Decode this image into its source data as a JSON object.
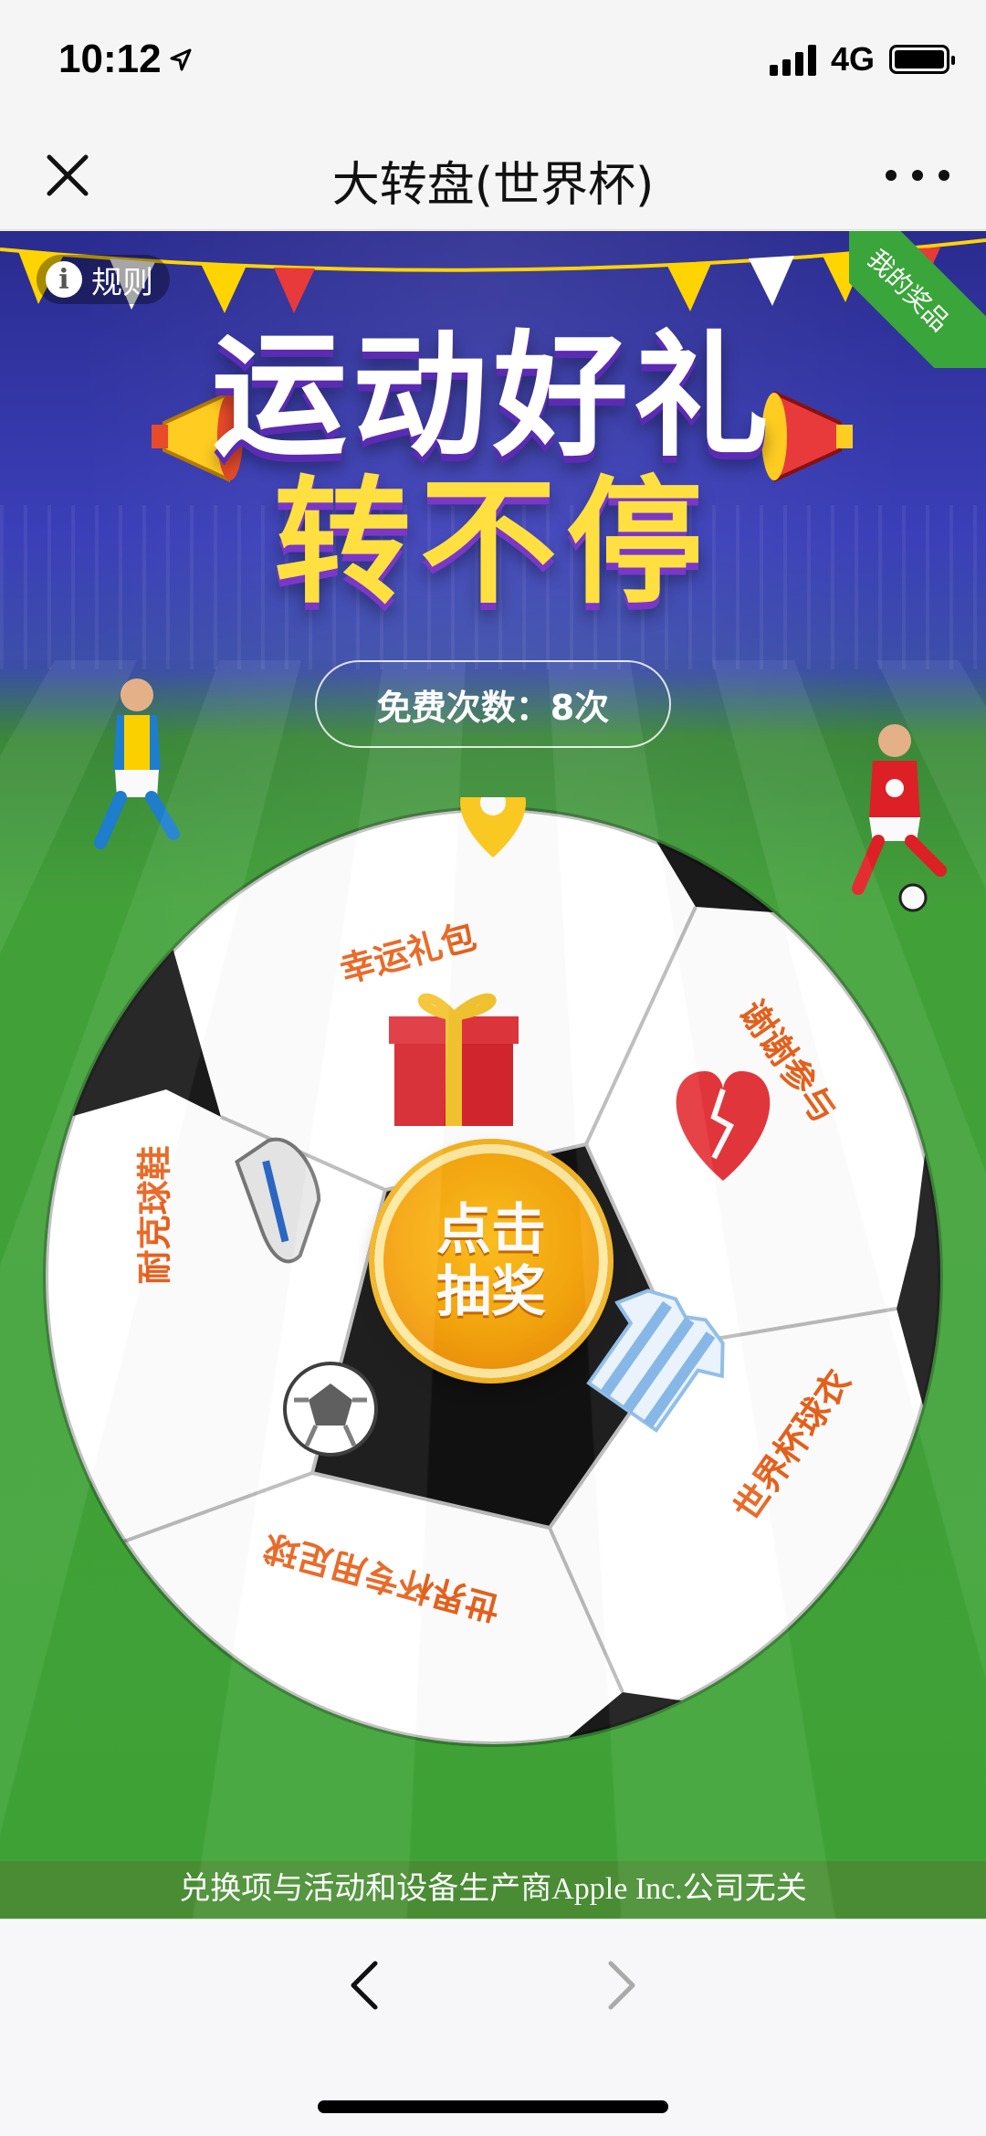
{
  "status_bar": {
    "time": "10:12",
    "network": "4G"
  },
  "nav": {
    "title": "大转盘(世界杯)"
  },
  "banner": {
    "rules_label": "规则",
    "my_prize_label": "我的奖品",
    "headline_line1": "运动好礼",
    "headline_line2": "转不停"
  },
  "free_count": {
    "text": "免费次数：8次"
  },
  "wheel": {
    "segments": [
      {
        "label": "幸运礼包",
        "icon": "gift-box-icon"
      },
      {
        "label": "谢谢参与",
        "icon": "broken-heart-icon"
      },
      {
        "label": "世界杯球衣",
        "icon": "jersey-icon"
      },
      {
        "label": "世界杯专用足球",
        "icon": "soccer-ball-icon"
      },
      {
        "label": "耐克球鞋",
        "icon": "football-boot-icon"
      }
    ],
    "button_line1": "点击",
    "button_line2": "抽奖"
  },
  "disclaimer": "兑换项与活动和设备生产商Apple Inc.公司无关",
  "colors": {
    "accent_orange": "#e8621c",
    "field_green": "#43a33a",
    "banner_blue": "#3b3fb8",
    "gold": "#f6a60d"
  }
}
